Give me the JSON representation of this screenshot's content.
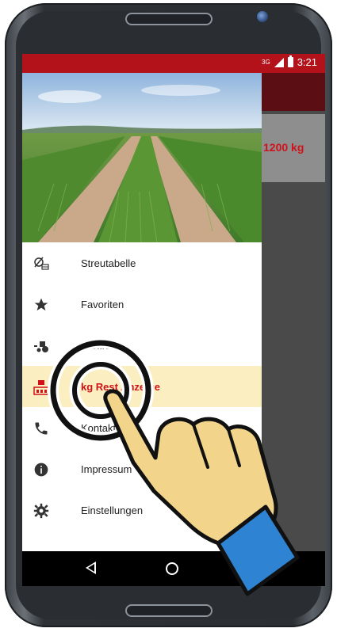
{
  "status_bar": {
    "network": "3G",
    "time": "3:21"
  },
  "background_card": {
    "value": "1200 kg"
  },
  "drawer": {
    "items": [
      {
        "label": "Streutabelle",
        "icon": "spread-table-icon"
      },
      {
        "label": "Favoriten",
        "icon": "star-icon"
      },
      {
        "label": "Profile",
        "icon": "tractor-icon"
      },
      {
        "label": "kg Rest Anzeige",
        "icon": "scale-weight-icon",
        "active": true
      },
      {
        "label": "Kontakt",
        "icon": "phone-icon"
      },
      {
        "label": "Impressum",
        "icon": "info-icon"
      },
      {
        "label": "Einstellungen",
        "icon": "gear-icon"
      }
    ]
  },
  "colors": {
    "accent": "#b3121b",
    "active_text": "#d0121b",
    "active_bg": "#fbeec0",
    "hand": "#f2d48a",
    "cuff": "#2f83d3"
  }
}
